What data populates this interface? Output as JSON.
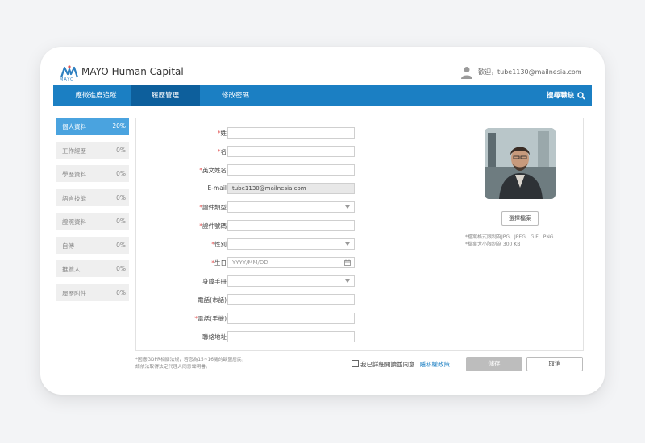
{
  "header": {
    "logo_sub": "MAYO",
    "brand": "MAYO Human Capital",
    "welcome": "歡迎，tube1130@mailnesia.com"
  },
  "nav": {
    "items": [
      {
        "label": "應徵進度追蹤"
      },
      {
        "label": "履歷管理"
      },
      {
        "label": "修改密碼"
      }
    ],
    "search_label": "搜尋職缺"
  },
  "sidebar": {
    "items": [
      {
        "label": "個人資料",
        "pct": "20%"
      },
      {
        "label": "工作經歷",
        "pct": "0%"
      },
      {
        "label": "學歷資料",
        "pct": "0%"
      },
      {
        "label": "語言技能",
        "pct": "0%"
      },
      {
        "label": "證照資料",
        "pct": "0%"
      },
      {
        "label": "自傳",
        "pct": "0%"
      },
      {
        "label": "推薦人",
        "pct": "0%"
      },
      {
        "label": "履歷附件",
        "pct": "0%"
      }
    ]
  },
  "form": {
    "last_name": {
      "label": "姓",
      "required": "*"
    },
    "first_name": {
      "label": "名",
      "required": "*"
    },
    "english_name": {
      "label": "英文姓名",
      "required": "*"
    },
    "email": {
      "label": "E-mail",
      "value": "tube1130@mailnesia.com"
    },
    "id_type": {
      "label": "證件類型",
      "required": "*"
    },
    "id_number": {
      "label": "證件號碼",
      "required": "*"
    },
    "gender": {
      "label": "性別",
      "required": "*"
    },
    "birthday": {
      "label": "生日",
      "required": "*",
      "placeholder": "YYYY/MM/DD"
    },
    "disability": {
      "label": "身障手冊"
    },
    "phone_home": {
      "label": "電話(市話)"
    },
    "phone_mobile": {
      "label": "電話(手機)",
      "required": "*"
    },
    "address": {
      "label": "聯絡地址"
    }
  },
  "photo": {
    "choose_label": "選擇檔案",
    "note1": "*檔案格式限制為JPG、JPEG、GIF、PNG",
    "note2": "*檔案大小限制為 300 KB"
  },
  "footer": {
    "gdpr_line1": "*因應GDPR相關法規，若您為15~16歲的歐盟居民，",
    "gdpr_line2": "請依法取得法定代理人同意聲明書。",
    "agree_text": "我已詳細閱讀並同意",
    "privacy_link": "隱私權政策",
    "save_label": "儲存",
    "cancel_label": "取消"
  },
  "colors": {
    "primary": "#1b7fc3",
    "nav_active": "#0d5f9c",
    "sidebar_active": "#4aa3df",
    "required": "#e05050"
  }
}
